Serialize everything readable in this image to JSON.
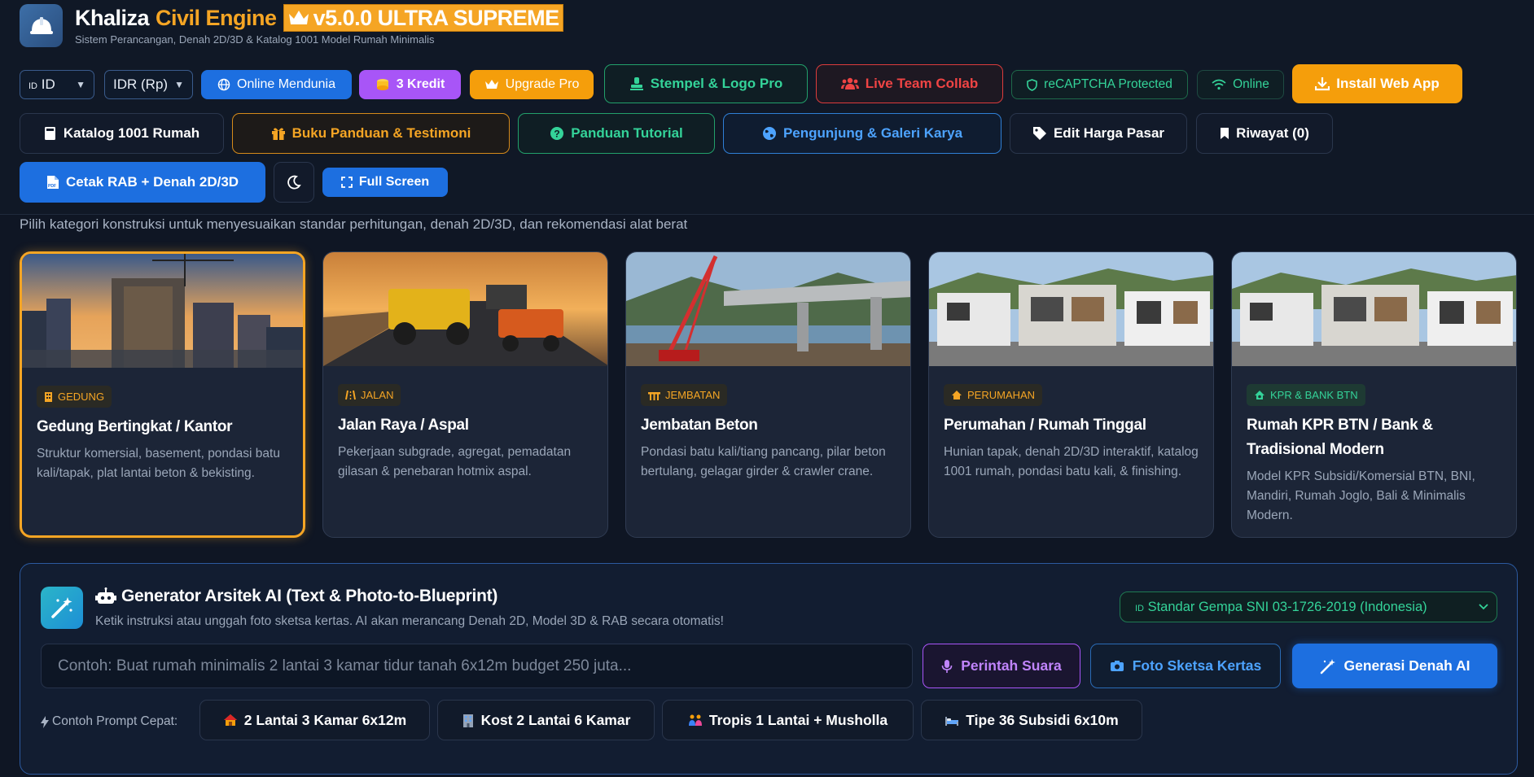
{
  "header": {
    "title_part1": "Khaliza",
    "title_part2": "Civil Engine",
    "version_badge": "v5.0.0 ULTRA SUPREME",
    "subtitle": "Sistem Perancangan, Denah 2D/3D & Katalog 1001 Model Rumah Minimalis"
  },
  "toolbar": {
    "language_flag": "ID",
    "language_value": "ID",
    "currency_value": "IDR (Rp)",
    "online_worldwide": "Online Mendunia",
    "credits": "3 Kredit",
    "upgrade": "Upgrade Pro",
    "stamp_logo": "Stempel & Logo Pro",
    "live_collab": "Live Team Collab",
    "recaptcha": "reCAPTCHA Protected",
    "online_status": "Online",
    "install_app": "Install Web App",
    "catalog": "Katalog 1001 Rumah",
    "guide_book": "Buku Panduan & Testimoni",
    "tutorial": "Panduan Tutorial",
    "visitors_gallery": "Pengunjung & Galeri Karya",
    "edit_prices": "Edit Harga Pasar",
    "history": "Riwayat (0)",
    "print_rab": "Cetak RAB + Denah 2D/3D",
    "fullscreen": "Full Screen"
  },
  "categories": {
    "description": "Pilih kategori konstruksi untuk menyesuaikan standar perhitungan, denah 2D/3D, dan rekomendasi alat berat",
    "items": [
      {
        "tag": "GEDUNG",
        "title": "Gedung Bertingkat / Kantor",
        "desc": "Struktur komersial, basement, pondasi batu kali/tapak, plat lantai beton & bekisting."
      },
      {
        "tag": "JALAN",
        "title": "Jalan Raya / Aspal",
        "desc": "Pekerjaan subgrade, agregat, pemadatan gilasan & penebaran hotmix aspal."
      },
      {
        "tag": "JEMBATAN",
        "title": "Jembatan Beton",
        "desc": "Pondasi batu kali/tiang pancang, pilar beton bertulang, gelagar girder & crawler crane."
      },
      {
        "tag": "PERUMAHAN",
        "title": "Perumahan / Rumah Tinggal",
        "desc": "Hunian tapak, denah 2D/3D interaktif, katalog 1001 rumah, pondasi batu kali, & finishing."
      },
      {
        "tag": "KPR & BANK BTN",
        "title": "Rumah KPR BTN / Bank & Tradisional Modern",
        "desc": "Model KPR Subsidi/Komersial BTN, BNI, Mandiri, Rumah Joglo, Bali & Minimalis Modern."
      }
    ]
  },
  "ai_generator": {
    "title": "Generator Arsitek AI (Text & Photo-to-Blueprint)",
    "subtitle": "Ketik instruksi atau unggah foto sketsa kertas. AI akan merancang Denah 2D, Model 3D & RAB secara otomatis!",
    "standard_flag": "ID",
    "standard_value": "Standar Gempa SNI 03-1726-2019 (Indonesia)",
    "prompt_placeholder": "Contoh: Buat rumah minimalis 2 lantai 3 kamar tidur tanah 6x12m budget 250 juta...",
    "voice_button": "Perintah Suara",
    "photo_button": "Foto Sketsa Kertas",
    "generate_button": "Generasi Denah AI",
    "quick_label": "Contoh Prompt Cepat:",
    "quick_prompts": [
      "2 Lantai 3 Kamar 6x12m",
      "Kost 2 Lantai 6 Kamar",
      "Tropis 1 Lantai + Musholla",
      "Tipe 36 Subsidi 6x10m"
    ]
  },
  "colors": {
    "background": "#0f1624",
    "accent_orange": "#f5a524",
    "accent_blue": "#1d6fe0",
    "accent_green": "#34d399",
    "accent_red": "#ef4444",
    "accent_purple": "#a855f7"
  }
}
